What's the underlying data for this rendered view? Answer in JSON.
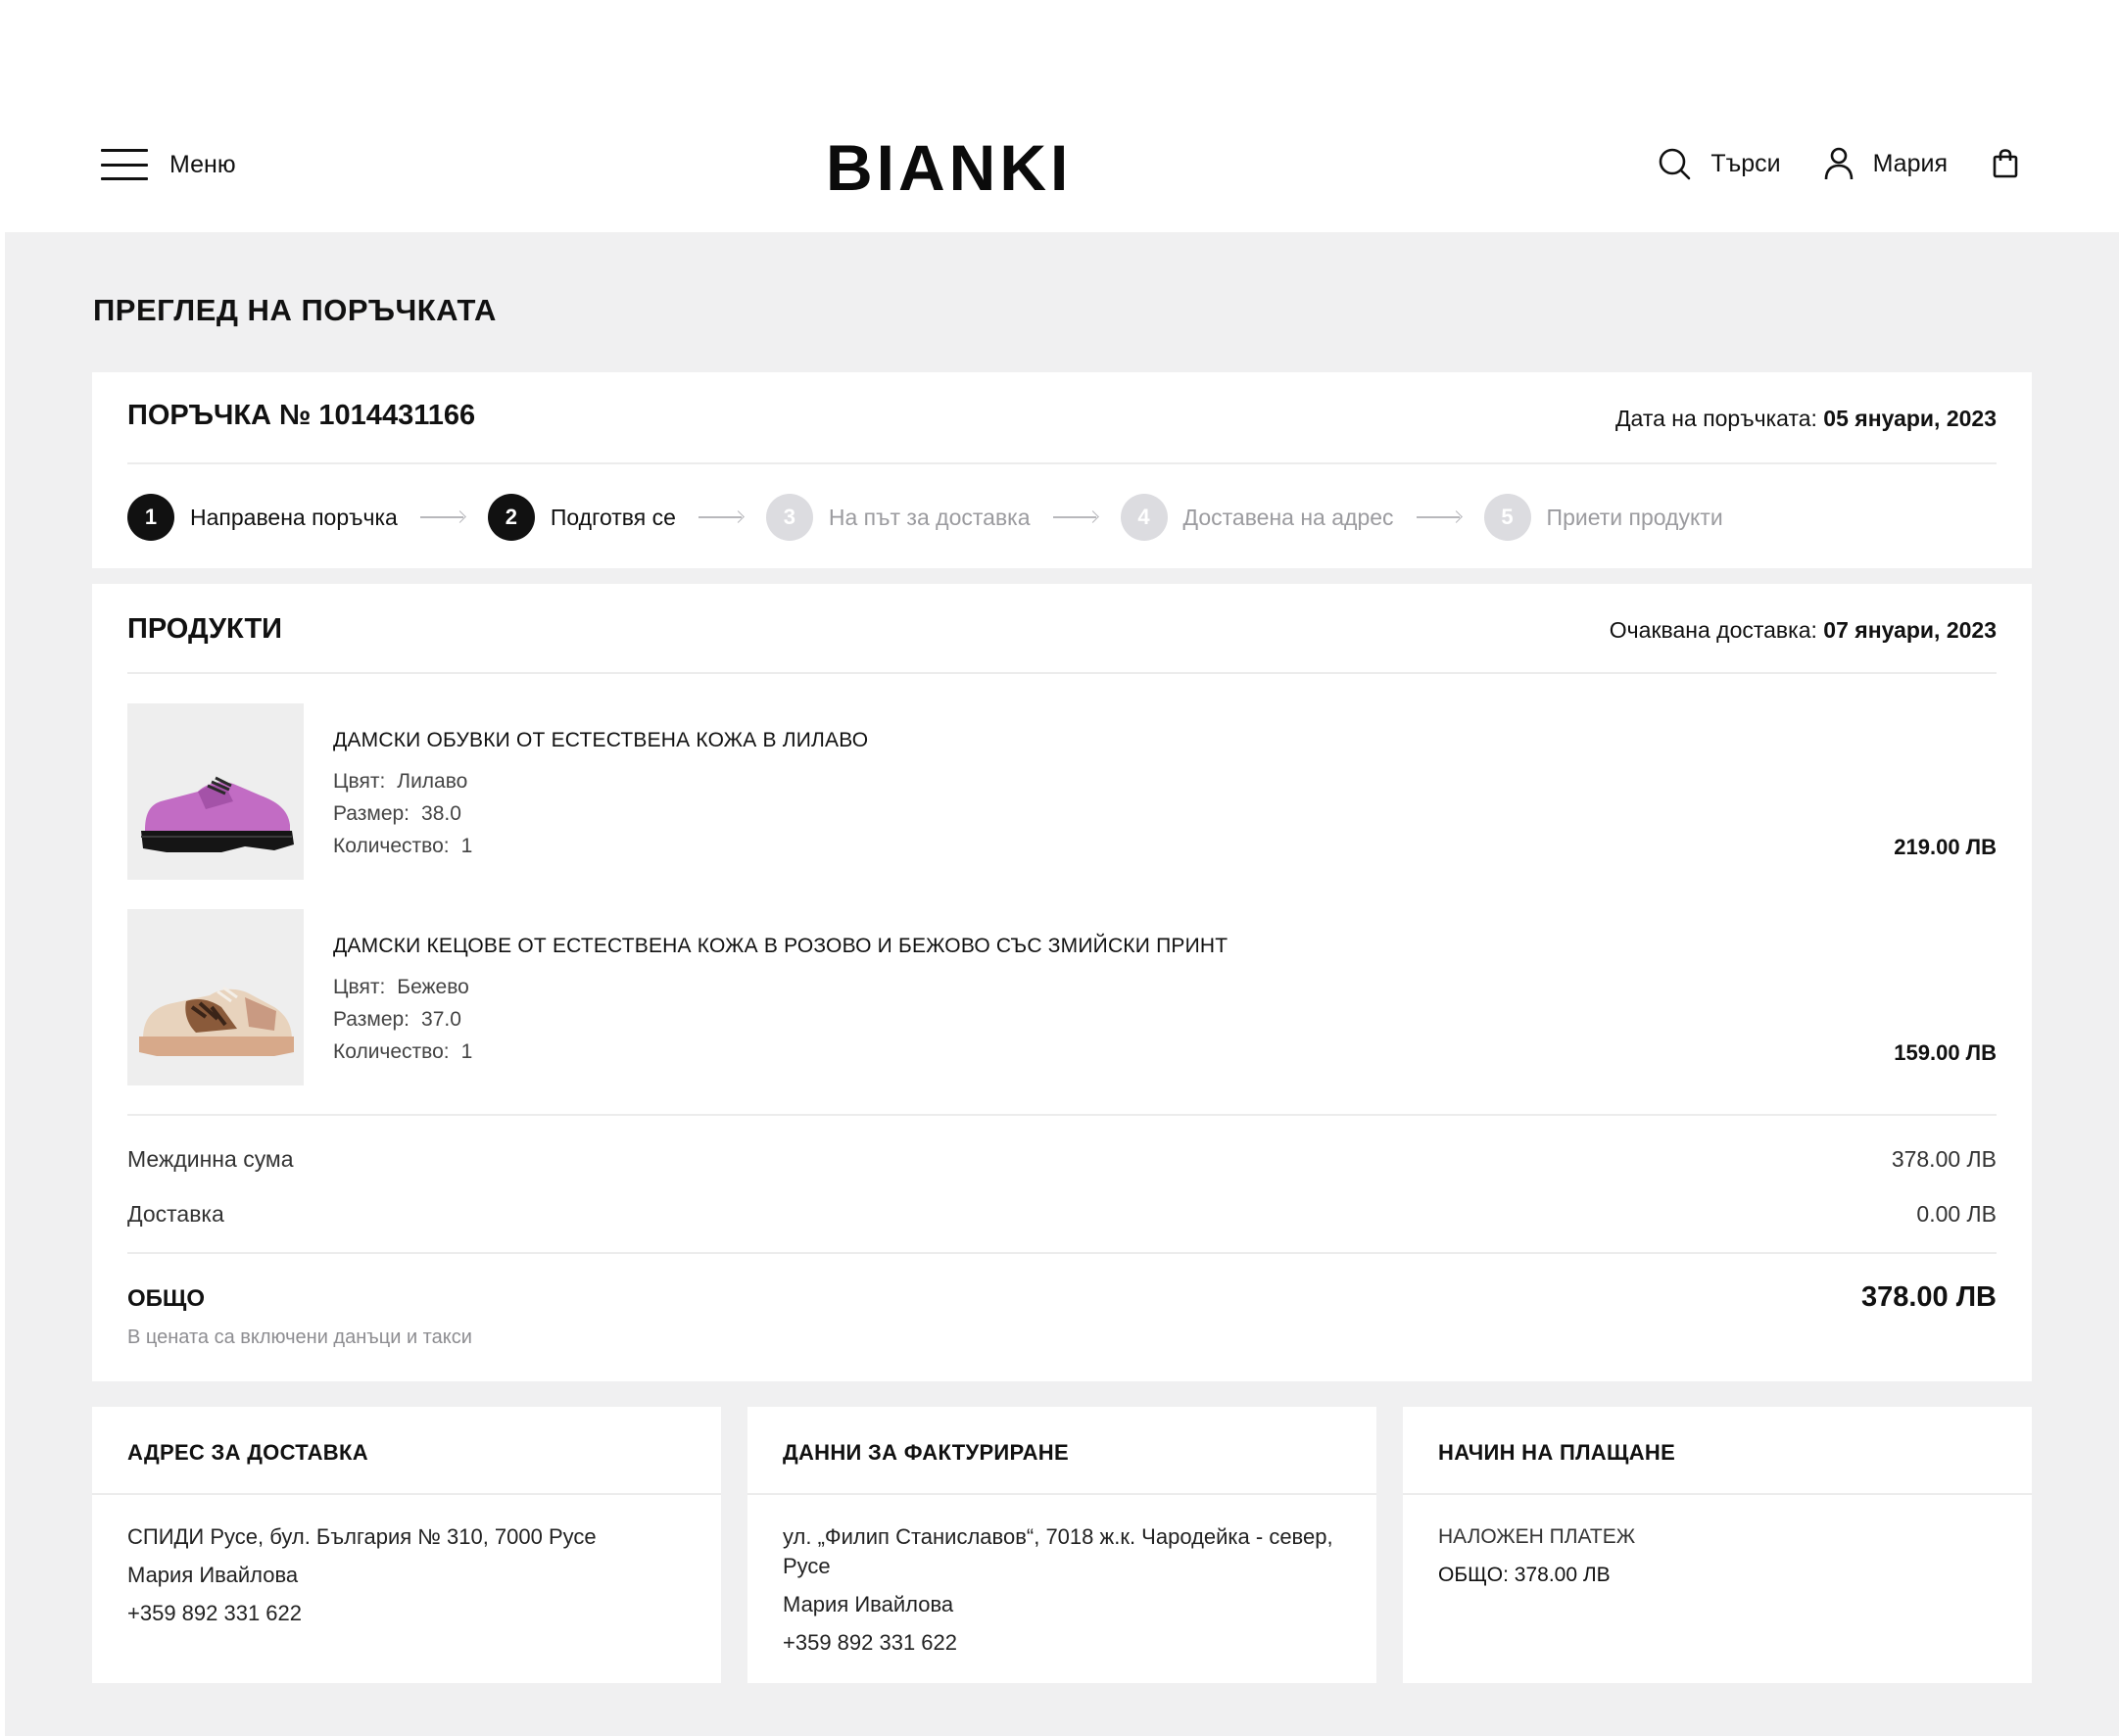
{
  "header": {
    "menu_label": "Меню",
    "logo": "BIANKI",
    "search_label": "Търси",
    "user_label": "Мария"
  },
  "page": {
    "title": "ПРЕГЛЕД НА ПОРЪЧКАТА"
  },
  "order": {
    "number_label": "ПОРЪЧКА № 1014431166",
    "date_label": "Дата на поръчката:",
    "date_value": "05 януари, 2023",
    "steps": [
      {
        "num": "1",
        "label": "Направена поръчка",
        "state": "done"
      },
      {
        "num": "2",
        "label": "Подготвя се",
        "state": "done"
      },
      {
        "num": "3",
        "label": "На път за доставка",
        "state": "pending"
      },
      {
        "num": "4",
        "label": "Доставена на адрес",
        "state": "pending"
      },
      {
        "num": "5",
        "label": "Приети продукти",
        "state": "pending"
      }
    ]
  },
  "products": {
    "heading": "ПРОДУКТИ",
    "delivery_label": "Очаквана доставка:",
    "delivery_value": "07 януари, 2023",
    "items": [
      {
        "name": "ДАМСКИ ОБУВКИ ОТ ЕСТЕСТВЕНА КОЖА В ЛИЛАВО",
        "color_label": "Цвят:",
        "color": "Лилаво",
        "size_label": "Размер:",
        "size": "38.0",
        "qty_label": "Количество:",
        "qty": "1",
        "price": "219.00 ЛВ"
      },
      {
        "name": "ДАМСКИ КЕЦОВЕ ОТ ЕСТЕСТВЕНА КОЖА В РОЗОВО И БЕЖОВО СЪС ЗМИЙСКИ ПРИНТ",
        "color_label": "Цвят:",
        "color": "Бежево",
        "size_label": "Размер:",
        "size": "37.0",
        "qty_label": "Количество:",
        "qty": "1",
        "price": "159.00 ЛВ"
      }
    ],
    "subtotal_label": "Междинна сума",
    "subtotal_value": "378.00 ЛВ",
    "shipping_label": "Доставка",
    "shipping_value": "0.00 ЛВ",
    "total_label": "ОБЩО",
    "total_value": "378.00 ЛВ",
    "tax_note": "В цената са включени данъци и такси"
  },
  "delivery_address": {
    "heading": "АДРЕС ЗА ДОСТАВКА",
    "line1": "СПИДИ Русе, бул. България № 310, 7000 Русе",
    "name": "Мария Ивайлова",
    "phone": "+359 892 331 622"
  },
  "billing": {
    "heading": "ДАННИ ЗА ФАКТУРИРАНЕ",
    "line1": "ул. „Филип Станиславов“, 7018 ж.к. Чародейка - север, Русе",
    "name": "Мария Ивайлова",
    "phone": "+359 892 331 622"
  },
  "payment": {
    "heading": "НАЧИН НА ПЛАЩАНЕ",
    "method": "НАЛОЖЕН ПЛАТЕЖ",
    "total": "ОБЩО: 378.00 ЛВ"
  },
  "colors": {
    "page_bg": "#f0f0f1",
    "step_done": "#111111",
    "step_pending": "#dcdce0",
    "shoe1": "#c46fc4",
    "shoe2": "#d6a98c"
  }
}
